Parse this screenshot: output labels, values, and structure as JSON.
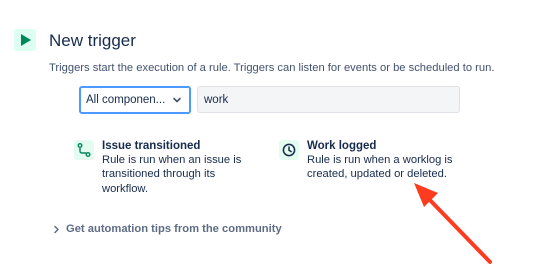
{
  "header": {
    "title": "New trigger",
    "subtitle": "Triggers start the execution of a rule. Triggers can listen for events or be scheduled to run."
  },
  "filters": {
    "component_select_value": "All componen...",
    "search_value": "work"
  },
  "triggers": [
    {
      "name": "Issue transitioned",
      "description": "Rule is run when an issue is\ntransitioned through its\nworkflow.",
      "icon": "workflow-transition-icon"
    },
    {
      "name": "Work logged",
      "description": "Rule is run when a worklog is\ncreated, updated or deleted.",
      "icon": "clock-icon"
    }
  ],
  "tips": {
    "label": "Get automation tips from the community"
  },
  "colors": {
    "accent_green": "#00875a",
    "icon_bg": "#e3fcef",
    "focus_blue": "#4c9aff",
    "annotation_red": "#ff3b1f"
  }
}
